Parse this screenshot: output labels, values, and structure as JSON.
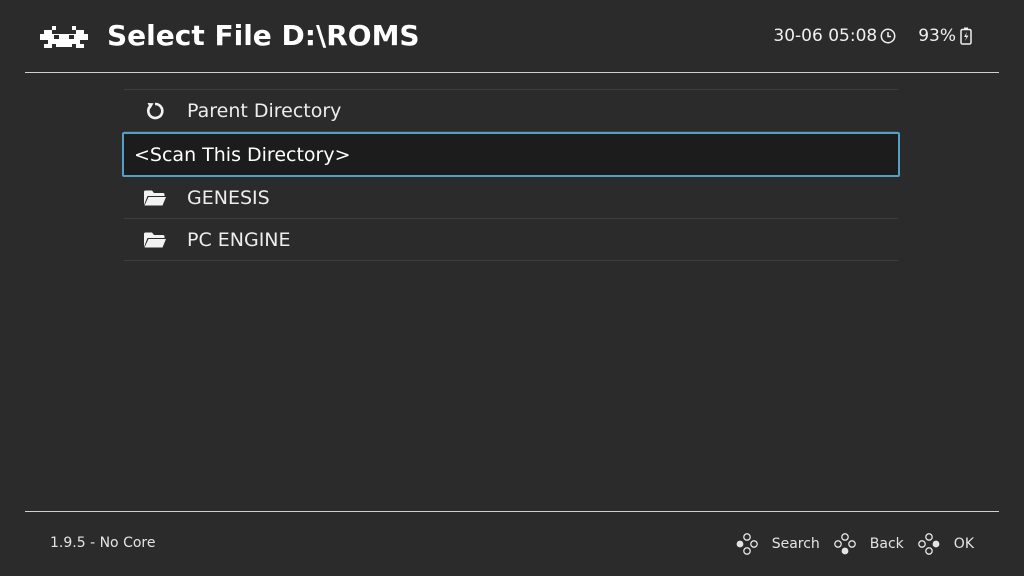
{
  "header": {
    "title": "Select File D:\\ROMS",
    "logo_icon": "retroarch-invader-icon",
    "datetime": "30-06 05:08",
    "clock_icon": "clock-icon",
    "battery_percent": "93%",
    "battery_icon": "battery-charging-icon"
  },
  "file_list": {
    "items": [
      {
        "label": "Parent Directory",
        "icon": "refresh-arrow-icon",
        "selected": false
      },
      {
        "label": "<Scan This Directory>",
        "icon": "",
        "selected": true
      },
      {
        "label": "GENESIS",
        "icon": "folder-icon",
        "selected": false
      },
      {
        "label": "PC ENGINE",
        "icon": "folder-icon",
        "selected": false
      }
    ]
  },
  "footer": {
    "version": "1.9.5 - No Core",
    "hints": [
      {
        "label": "Search",
        "icon": "gamepad-button-left-icon"
      },
      {
        "label": "Back",
        "icon": "gamepad-button-bottom-icon"
      },
      {
        "label": "OK",
        "icon": "gamepad-button-right-icon"
      }
    ]
  },
  "colors": {
    "background": "#2b2b2b",
    "selection_border": "#52a0c8",
    "selection_background": "#1c1c1c",
    "divider": "#cfcfcf",
    "text": "#ececec"
  }
}
